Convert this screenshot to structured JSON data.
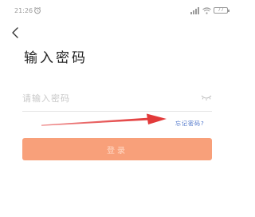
{
  "status_bar": {
    "time": "21:26",
    "alarm_icon": "alarm-clock-icon",
    "wifi_icon": "wifi-icon",
    "signal_icon": "signal-icon",
    "battery_level": "77"
  },
  "header": {
    "back_icon": "chevron-left-icon",
    "title": "输入密码"
  },
  "password": {
    "placeholder": "请输入密码",
    "value": "",
    "toggle_icon": "eye-closed-icon"
  },
  "forgot_password": {
    "label": "忘记密码?"
  },
  "login": {
    "label": "登录",
    "enabled": false
  },
  "annotation": {
    "type": "arrow",
    "color": "#e23a3a",
    "points_to": "forgot-password-link"
  },
  "colors": {
    "accent": "#f8a07a",
    "link": "#4b73c9",
    "annotation": "#e23a3a"
  }
}
